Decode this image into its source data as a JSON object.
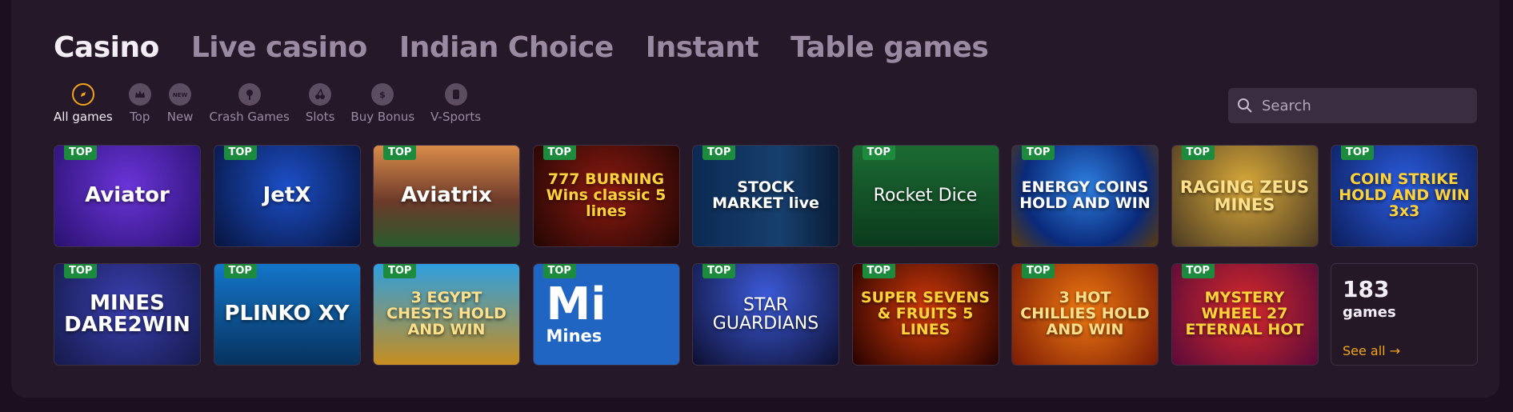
{
  "tabs": [
    {
      "label": "Casino",
      "active": true
    },
    {
      "label": "Live casino"
    },
    {
      "label": "Indian Choice"
    },
    {
      "label": "Instant"
    },
    {
      "label": "Table games"
    }
  ],
  "categories": [
    {
      "label": "All games",
      "icon": "compass-icon",
      "active": true
    },
    {
      "label": "Top",
      "icon": "crown-icon"
    },
    {
      "label": "New",
      "icon": "new-badge-icon"
    },
    {
      "label": "Crash Games",
      "icon": "explosion-icon"
    },
    {
      "label": "Slots",
      "icon": "cherry-icon"
    },
    {
      "label": "Buy Bonus",
      "icon": "money-bag-icon"
    },
    {
      "label": "V-Sports",
      "icon": "sports-icon"
    }
  ],
  "search": {
    "placeholder": "Search"
  },
  "badge_label": "TOP",
  "games": [
    {
      "name": "Aviator"
    },
    {
      "name": "JetX"
    },
    {
      "name": "Aviatrix"
    },
    {
      "name": "777 BURNING Wins classic 5 lines"
    },
    {
      "name": "STOCK MARKET live"
    },
    {
      "name": "Rocket Dice"
    },
    {
      "name": "ENERGY COINS HOLD AND WIN"
    },
    {
      "name": "RAGING ZEUS MINES"
    },
    {
      "name": "COIN STRIKE HOLD AND WIN 3x3"
    },
    {
      "name": "MINES DARE2WIN"
    },
    {
      "name": "PLINKO XY"
    },
    {
      "name": "3 EGYPT CHESTS HOLD AND WIN"
    },
    {
      "name_big": "Mi",
      "name_small": "Mines"
    },
    {
      "name": "STAR GUARDIANS"
    },
    {
      "name": "SUPER SEVENS & FRUITS 5 LINES"
    },
    {
      "name": "3 HOT CHILLIES HOLD AND WIN"
    },
    {
      "name": "MYSTERY WHEEL 27 ETERNAL HOT"
    }
  ],
  "see_all": {
    "count": "183",
    "unit": "games",
    "link": "See all →"
  },
  "colors": {
    "accent": "#f2a51a",
    "badge": "#1d8b3d",
    "panel": "#251829",
    "page": "#1c1020"
  }
}
